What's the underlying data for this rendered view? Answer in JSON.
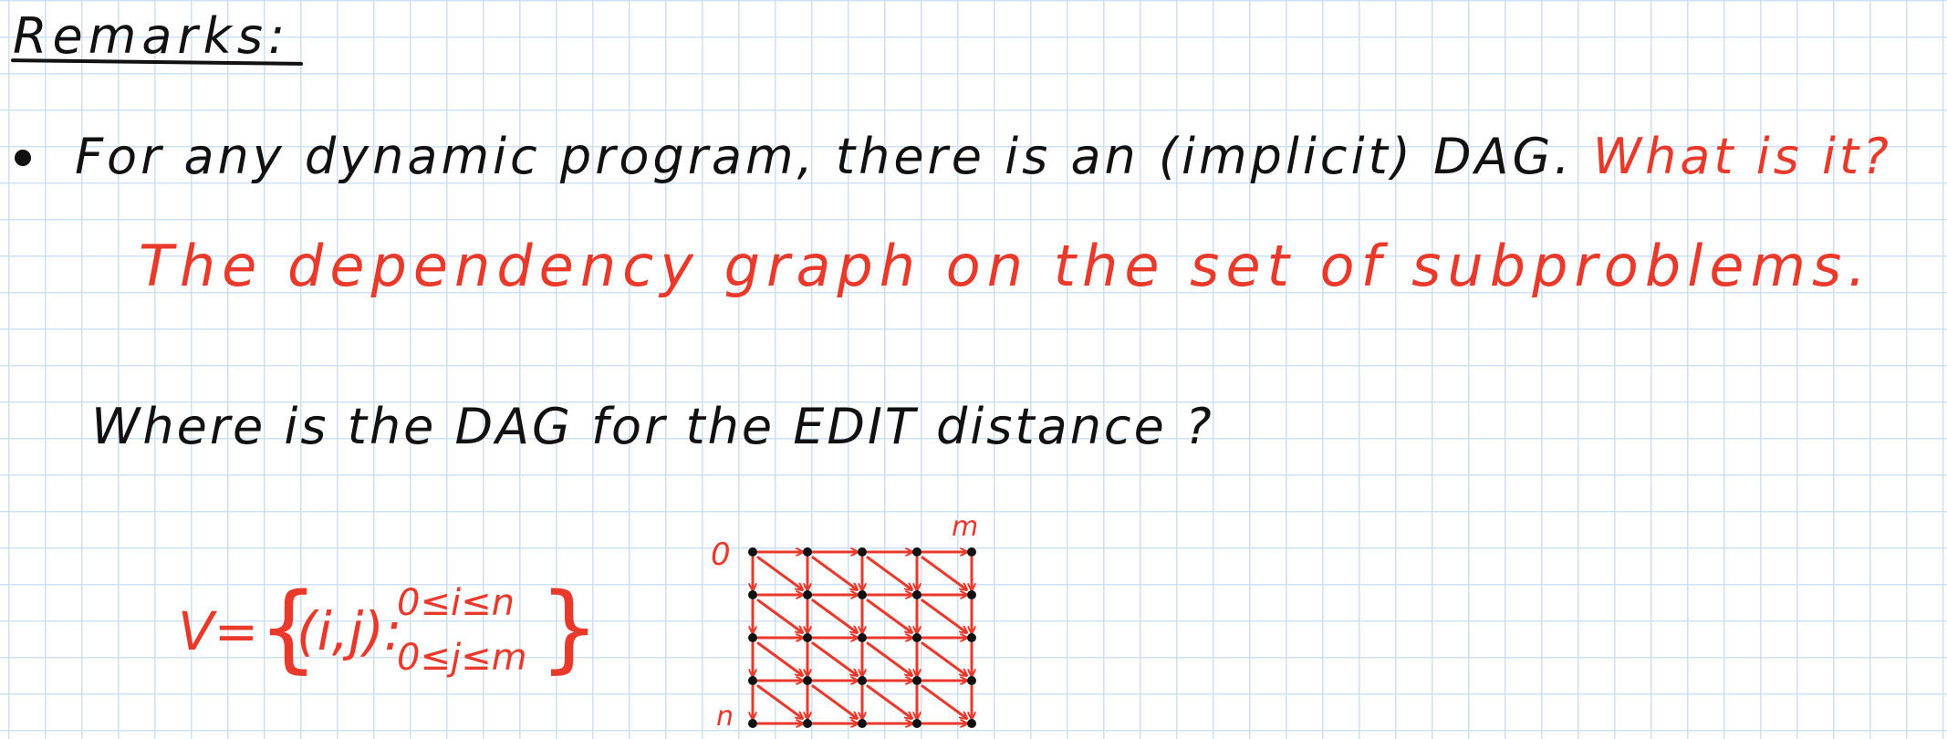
{
  "heading": "Remarks:",
  "bullet": {
    "statement": "For any dynamic program, there is an (implicit) DAG.",
    "question": "What is it?"
  },
  "answer": "The dependency graph on the set of subproblems.",
  "edit_question": "Where is the DAG for the EDIT distance ?",
  "vertex_set": {
    "prefix": "V=",
    "pair": "(i,j):",
    "condition_i": "0≤i≤n",
    "condition_j": "0≤j≤m"
  },
  "grid_labels": {
    "origin": "0",
    "columns_end": "m",
    "rows_end": "n"
  },
  "colors": {
    "ink": "#111111",
    "red_ink": "#e8392b",
    "grid_paper": "#cfe1f3"
  }
}
